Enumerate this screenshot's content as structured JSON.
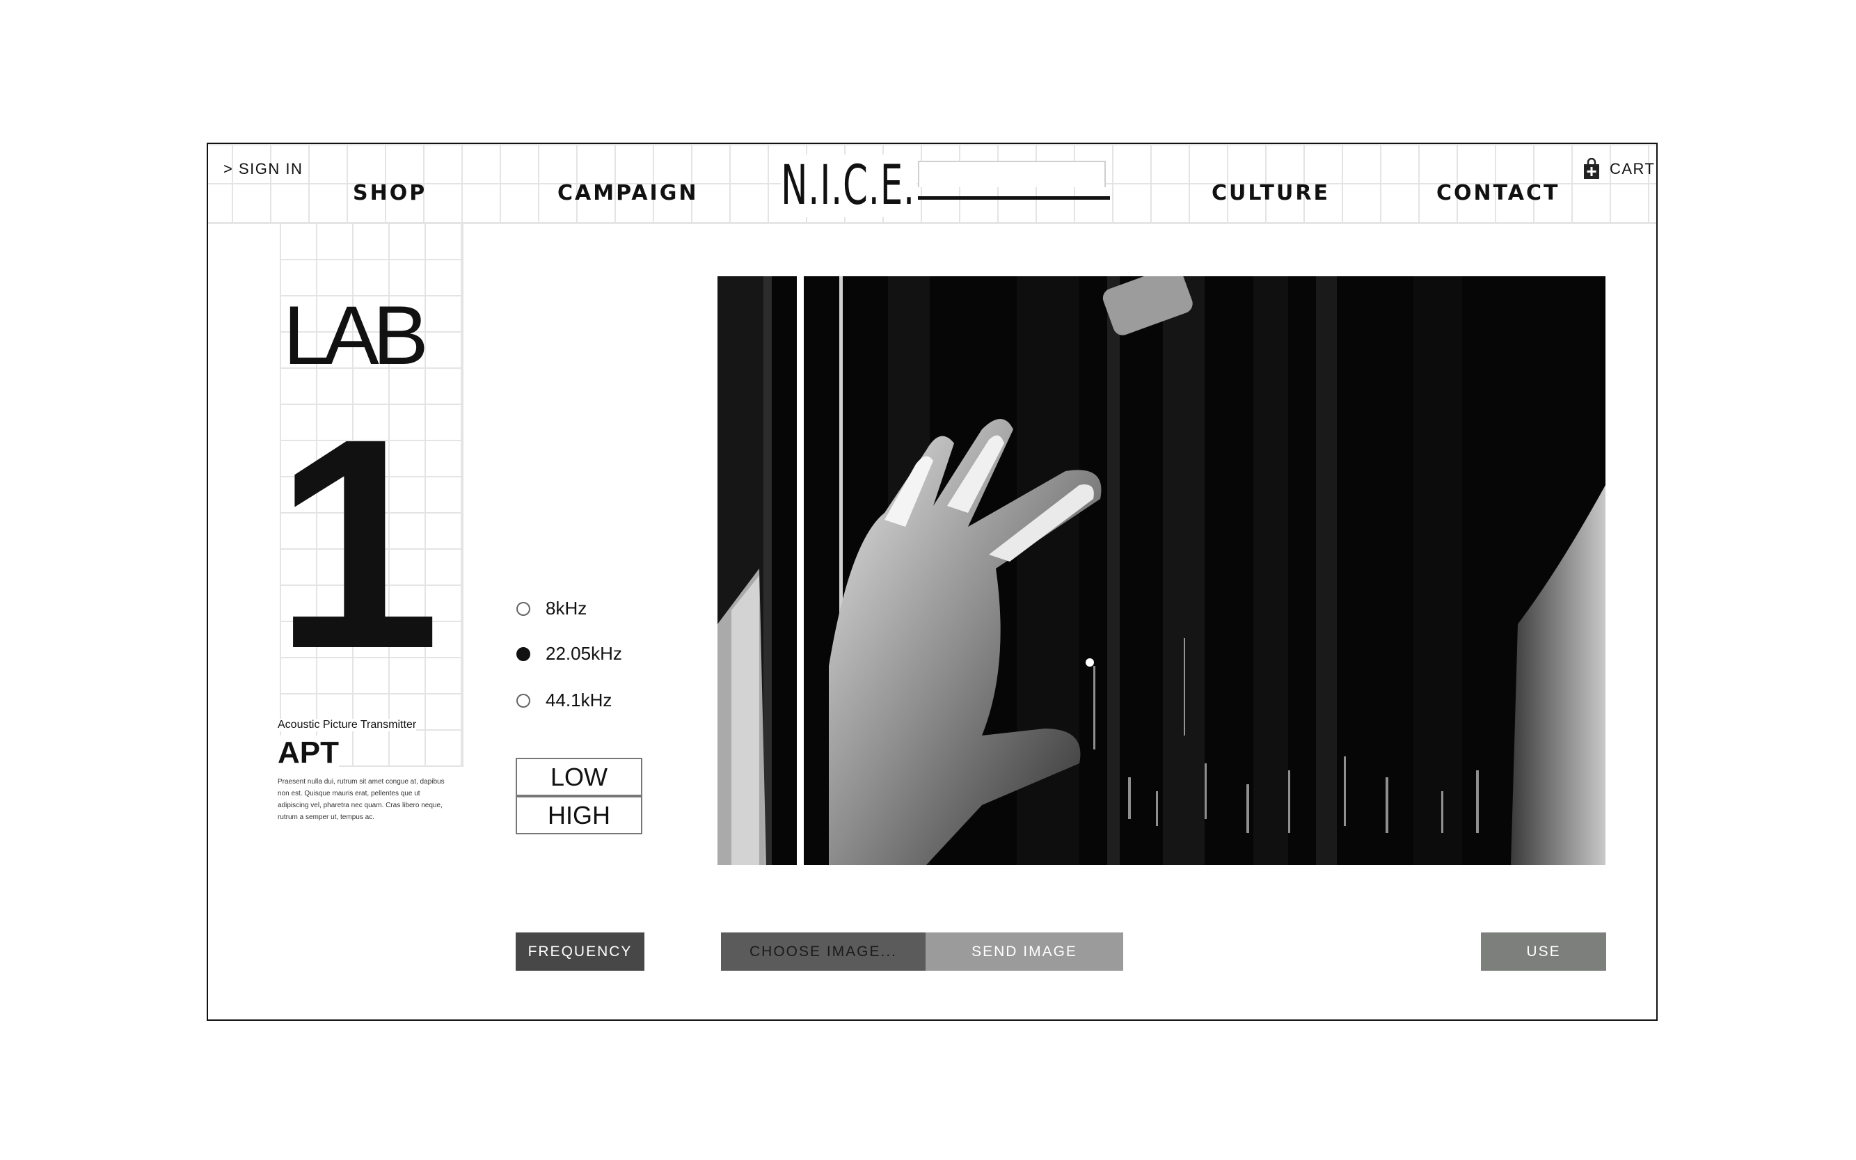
{
  "header": {
    "sign_in": "> SIGN IN",
    "nav": {
      "shop": "SHOP",
      "campaign": "CAMPAIGN",
      "culture": "CULTURE",
      "contact": "CONTACT"
    },
    "logo": "N.I.C.E.",
    "search_value": "",
    "cart": "CART"
  },
  "lab": {
    "title": "LAB",
    "number": "1",
    "subtitle": "Acoustic Picture Transmitter",
    "name": "APT",
    "description": "Praesent nulla dui, rutrum sit amet congue at, dapibus non est. Quisque mauris erat, pellentes que ut adipiscing vel, pharetra nec quam. Cras libero neque, rutrum a semper ut, tempus ac."
  },
  "frequency_options": [
    {
      "label": "8kHz",
      "selected": false
    },
    {
      "label": "22.05kHz",
      "selected": true
    },
    {
      "label": "44.1kHz",
      "selected": false
    }
  ],
  "quality": {
    "low": "LOW",
    "high": "HIGH"
  },
  "buttons": {
    "frequency": "FREQUENCY",
    "choose_image": "CHOOSE IMAGE...",
    "send_image": "SEND IMAGE",
    "use": "USE"
  },
  "colors": {
    "frequency_button": "#474747",
    "choose_button": "#5b5b5b",
    "send_button": "#9b9b9b",
    "use_button": "#7c7f7b"
  },
  "icons": {
    "cart": "shopping-bag-plus-icon",
    "radio": "radio-circle"
  }
}
